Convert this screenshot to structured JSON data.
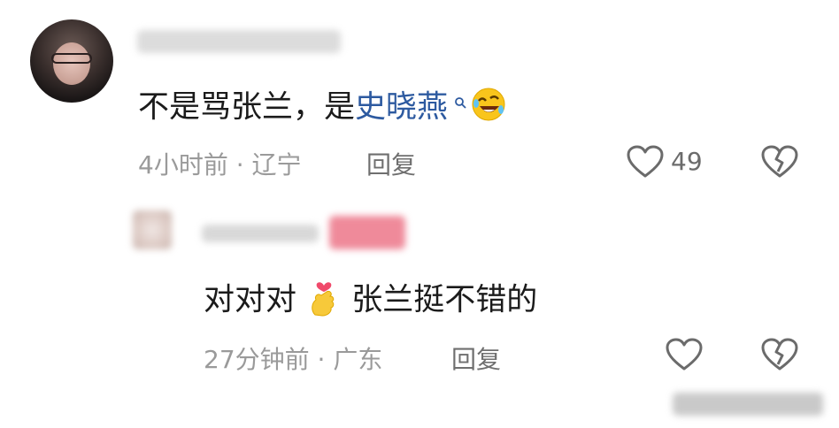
{
  "comments": [
    {
      "text": "不是骂张兰，是",
      "link_text": "史晓燕",
      "emoji": "rolling-laughing-emoji",
      "time": "4小时前",
      "location": "辽宁",
      "reply_label": "回复",
      "likes": "49"
    }
  ],
  "reply": {
    "text_prefix": "对对对",
    "emoji": "heart-finger-emoji",
    "text_suffix": "张兰挺不错的",
    "time": "27分钟前",
    "location": "广东",
    "reply_label": "回复"
  },
  "icons": {
    "like": "heart-outline-icon",
    "dislike": "broken-heart-icon",
    "search": "search-icon"
  },
  "colors": {
    "link": "#2d5aa0",
    "meta": "#9a9a9a"
  }
}
